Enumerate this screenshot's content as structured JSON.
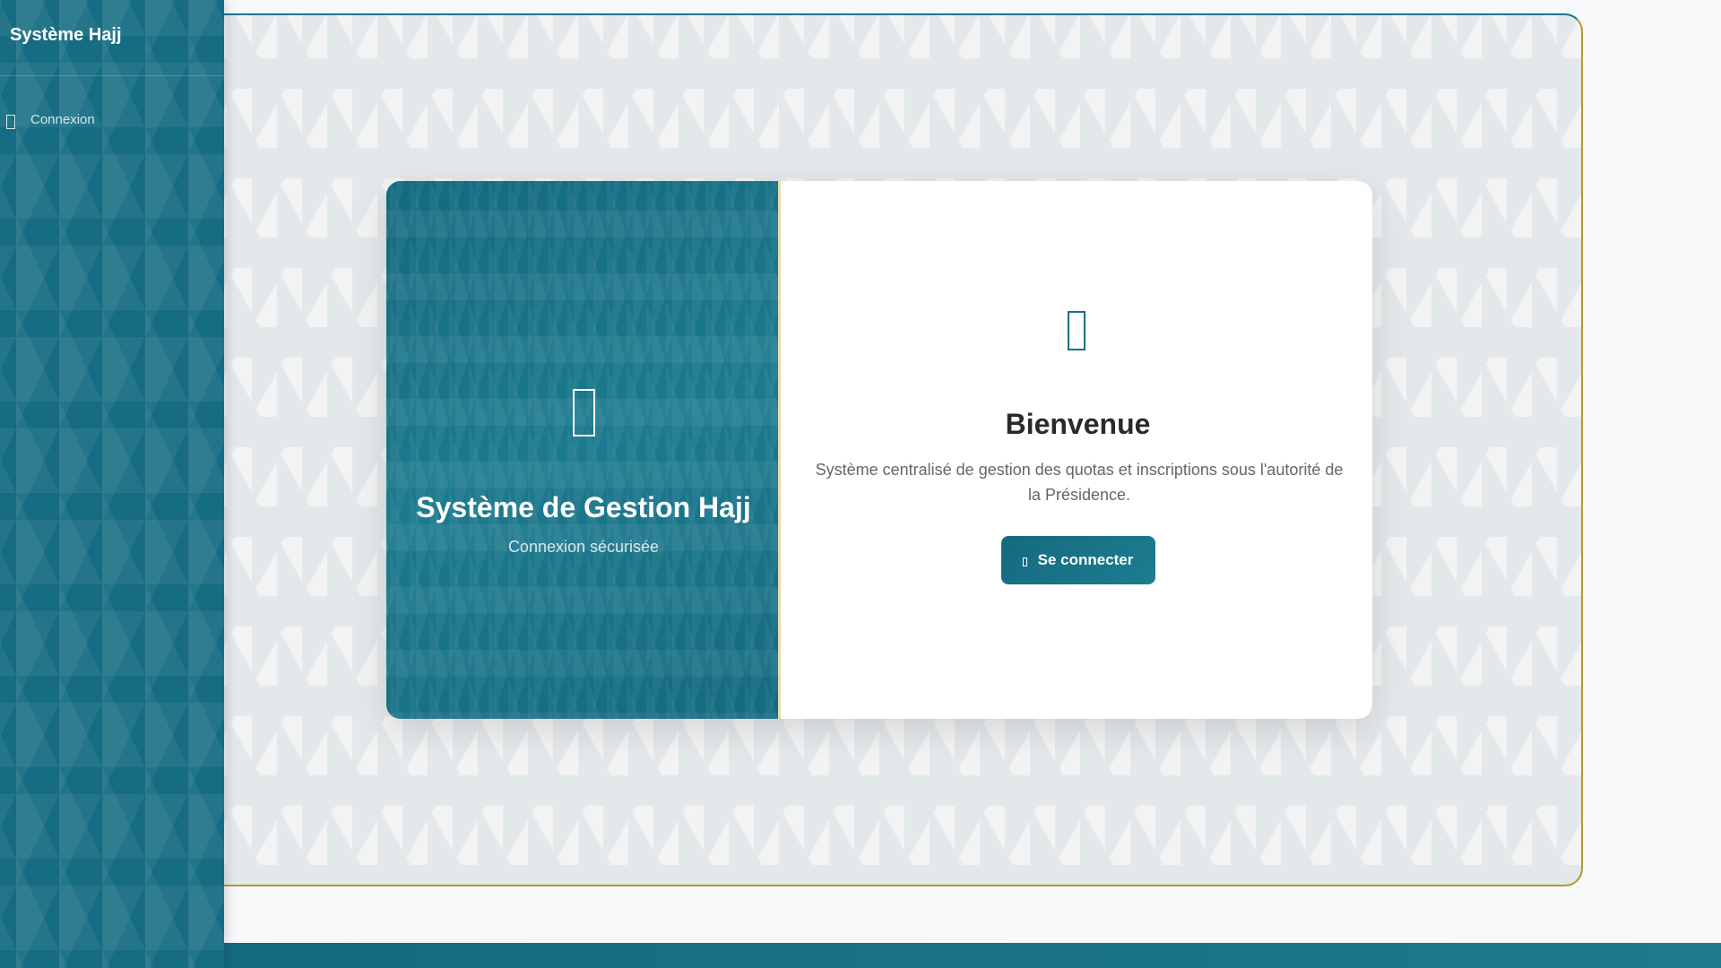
{
  "sidebar": {
    "brand": "Système Hajj",
    "items": [
      {
        "label": "Connexion",
        "icon": "login-icon"
      }
    ]
  },
  "login_card": {
    "left": {
      "title": "Système de Gestion Hajj",
      "subtitle": "Connexion sécurisée",
      "icon": "kaaba-icon"
    },
    "right": {
      "icon": "mosque-icon",
      "heading": "Bienvenue",
      "description": "Système centralisé de gestion des quotas et inscriptions sous l'autorité de la Présidence.",
      "button_label": "Se connecter",
      "button_icon": "sign-in-icon"
    }
  },
  "colors": {
    "primary": "#166c82",
    "accent": "#b49a2e",
    "background": "#f3f3f3"
  }
}
